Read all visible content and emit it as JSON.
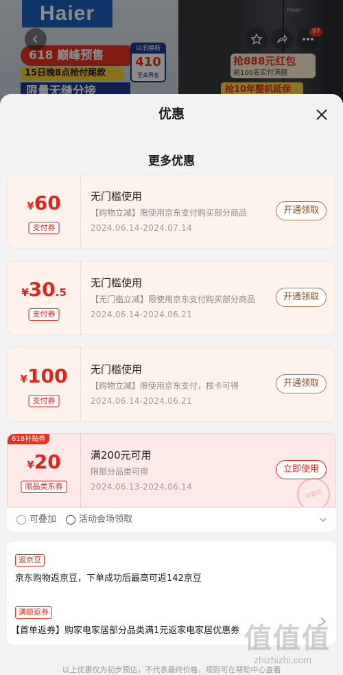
{
  "banner": {
    "brand": "Haier",
    "promo_618": "618 巅峰预售",
    "promo_15": "15日晚8点抢付尾款",
    "promo_big": "限量无缝分接",
    "trade_in": {
      "top": "以旧换新",
      "amount": "410",
      "bottom": "至高再省"
    },
    "fridge_brand": "Haier",
    "hongbao_title": "抢888元红包",
    "hongbao_sub": "前100名实付满额",
    "warranty": "抢10年整机延保",
    "message_count": "97"
  },
  "sheet": {
    "title": "优惠",
    "section_title": "更多优惠"
  },
  "coupons": [
    {
      "currency": "¥",
      "amount": "60",
      "decimal": "",
      "type_tag": "支付券",
      "title": "无门槛使用",
      "desc": "【购物立减】限使用京东支付购买部分商品",
      "date": "2024.06.14-2024.07.14",
      "button": "开通领取"
    },
    {
      "currency": "¥",
      "amount": "30",
      "decimal": ".5",
      "type_tag": "支付券",
      "title": "无门槛使用",
      "desc": "【无门槛立减】限使用京东支付购买部分商品",
      "date": "2024.06.14-2024.06.21",
      "button": "开通领取"
    },
    {
      "currency": "¥",
      "amount": "100",
      "decimal": "",
      "type_tag": "支付券",
      "title": "无门槛使用",
      "desc": "【购物立减】限使用京东支付，核卡可得",
      "date": "2024.06.14-2024.06.21",
      "button": "开通领取"
    },
    {
      "badge": "618补贴券",
      "currency": "¥",
      "amount": "20",
      "decimal": "",
      "type_tag": "限品类东券",
      "title": "满200元可用",
      "desc": "限部分品类可用",
      "date": "2024.06.13-2024.06.14",
      "button": "立即使用",
      "stamp": "可叠加"
    }
  ],
  "footer": {
    "stackable": "可叠加",
    "venue": "活动会场领取"
  },
  "rebates": [
    {
      "tag": "返京豆",
      "text": "京东购物返京豆，下单成功后最高可返142京豆"
    },
    {
      "tag": "满额返券",
      "text": "【首单返券】购家电家居部分品类满1元返家电家居优惠券"
    }
  ],
  "disclaimer": "以上优惠仅为初步预估，不代表最终价格，规则可在帮助中心查看",
  "watermark": {
    "logo": "值值值",
    "url": "zhizhizhi.com"
  },
  "colors": {
    "accent_red": "#e0261c",
    "button_brown": "#8a4a1c",
    "coupon_bg": "#fdf3ec",
    "subsidy_bg": "#fde9e8"
  }
}
